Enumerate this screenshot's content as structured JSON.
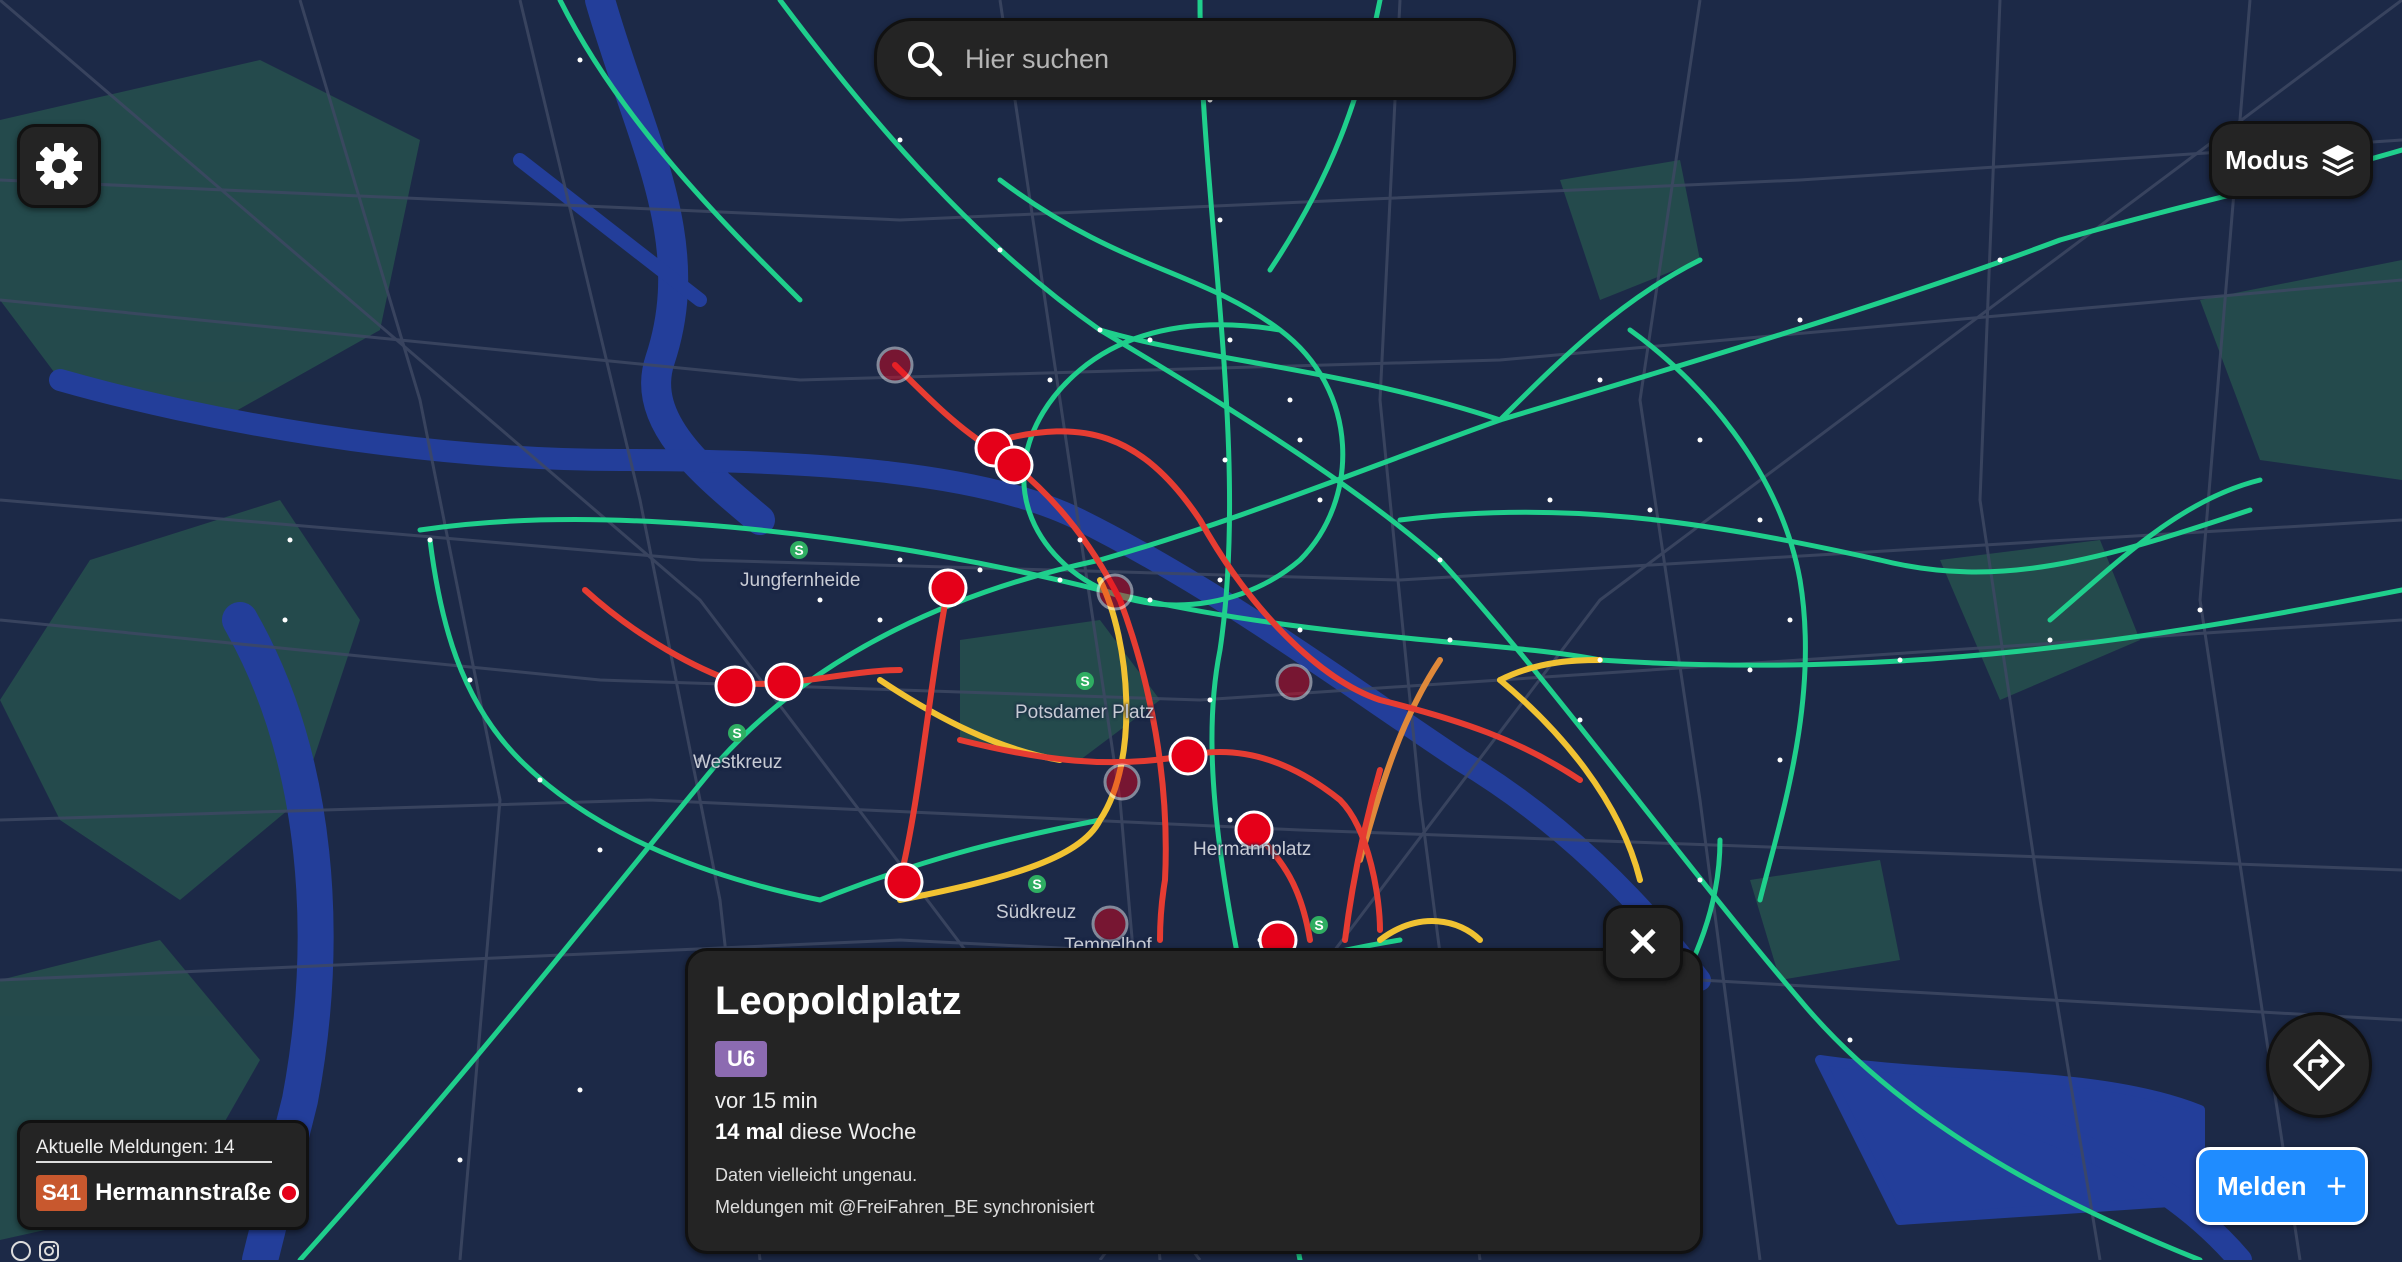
{
  "search": {
    "placeholder": "Hier suchen"
  },
  "mode_button": {
    "label": "Modus"
  },
  "report_button": {
    "label": "Melden",
    "plus": "+"
  },
  "reports_panel": {
    "count_label": "Aktuelle Meldungen: 14",
    "line": "S41",
    "station": "Hermannstraße"
  },
  "popup": {
    "title": "Leopoldplatz",
    "line": "U6",
    "time_ago": "vor 15 min",
    "frequency_bold": "14 mal",
    "frequency_rest": " diese Woche",
    "note1": "Daten vielleicht ungenau.",
    "note2": "Meldungen mit @FreiFahren_BE synchronisiert",
    "close": "✕"
  },
  "map_labels": {
    "jungfernheide": "Jungfernheide",
    "westkreuz": "Westkreuz",
    "potsdamer_platz": "Potsdamer Platz",
    "hermannplatz": "Hermannplatz",
    "suedkreuz": "Südkreuz",
    "tempelhof": "Tempelhof"
  },
  "colors": {
    "background": "#1c2947",
    "water": "#233e9a",
    "park": "#264e4c",
    "street": "#3d4863",
    "line_green": "#1fcf8c",
    "line_red": "#e63c32",
    "line_orange": "#e0893a",
    "line_yellow": "#f1c232",
    "marker": "#e50019",
    "panel": "#242424",
    "accent": "#1f8cff",
    "u6": "#8c6bb1",
    "s41": "#c8582e"
  },
  "icons": [
    "search-icon",
    "gear-icon",
    "layers-icon",
    "route-icon",
    "close-icon",
    "github-icon",
    "instagram-icon"
  ]
}
